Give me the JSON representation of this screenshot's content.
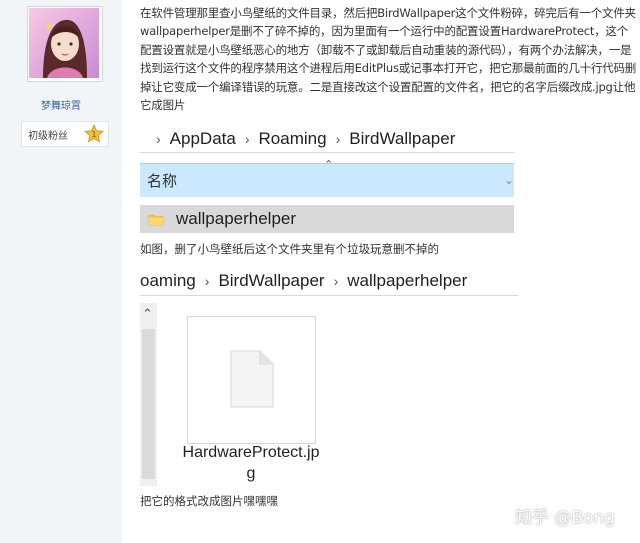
{
  "user": {
    "username": "梦舞琼霄",
    "rank": "初级粉丝",
    "rank_badge": "1"
  },
  "post": {
    "paragraph": "在软件管理那里查小鸟壁纸的文件目录，然后把BirdWallpaper这个文件粉碎，碎完后有一个文件夹wallpaperhelper是删不了碎不掉的，因为里面有一个运行中的配置设置HardwareProtect，这个配置设置就是小鸟壁纸恶心的地方（卸载不了或卸载后自动重装的源代码），有两个办法解决，一是找到运行这个文件的程序禁用这个进程后用EditPlus或记事本打开它，把它那最前面的几十行代码删掉让它变成一个编译错误的玩意。二是直接改这个设置配置的文件名，把它的名字后缀改成.jpg让他它成图片",
    "caption1": "如图，删了小鸟壁纸后这个文件夹里有个垃圾玩意删不掉的",
    "caption2": "把它的格式改成图片嘿嘿嘿"
  },
  "explorer1": {
    "path": [
      "AppData",
      "Roaming",
      "BirdWallpaper"
    ],
    "column_header": "名称",
    "folder_name": "wallpaperhelper"
  },
  "explorer2": {
    "path": [
      "oaming",
      "BirdWallpaper",
      "wallpaperhelper"
    ],
    "file_name": "HardwareProtect.jpg"
  },
  "watermark": "知乎 @Bong",
  "colors": {
    "header_bg": "#cce8ff",
    "selected_row": "#d9d9d9",
    "username": "#33639b"
  }
}
